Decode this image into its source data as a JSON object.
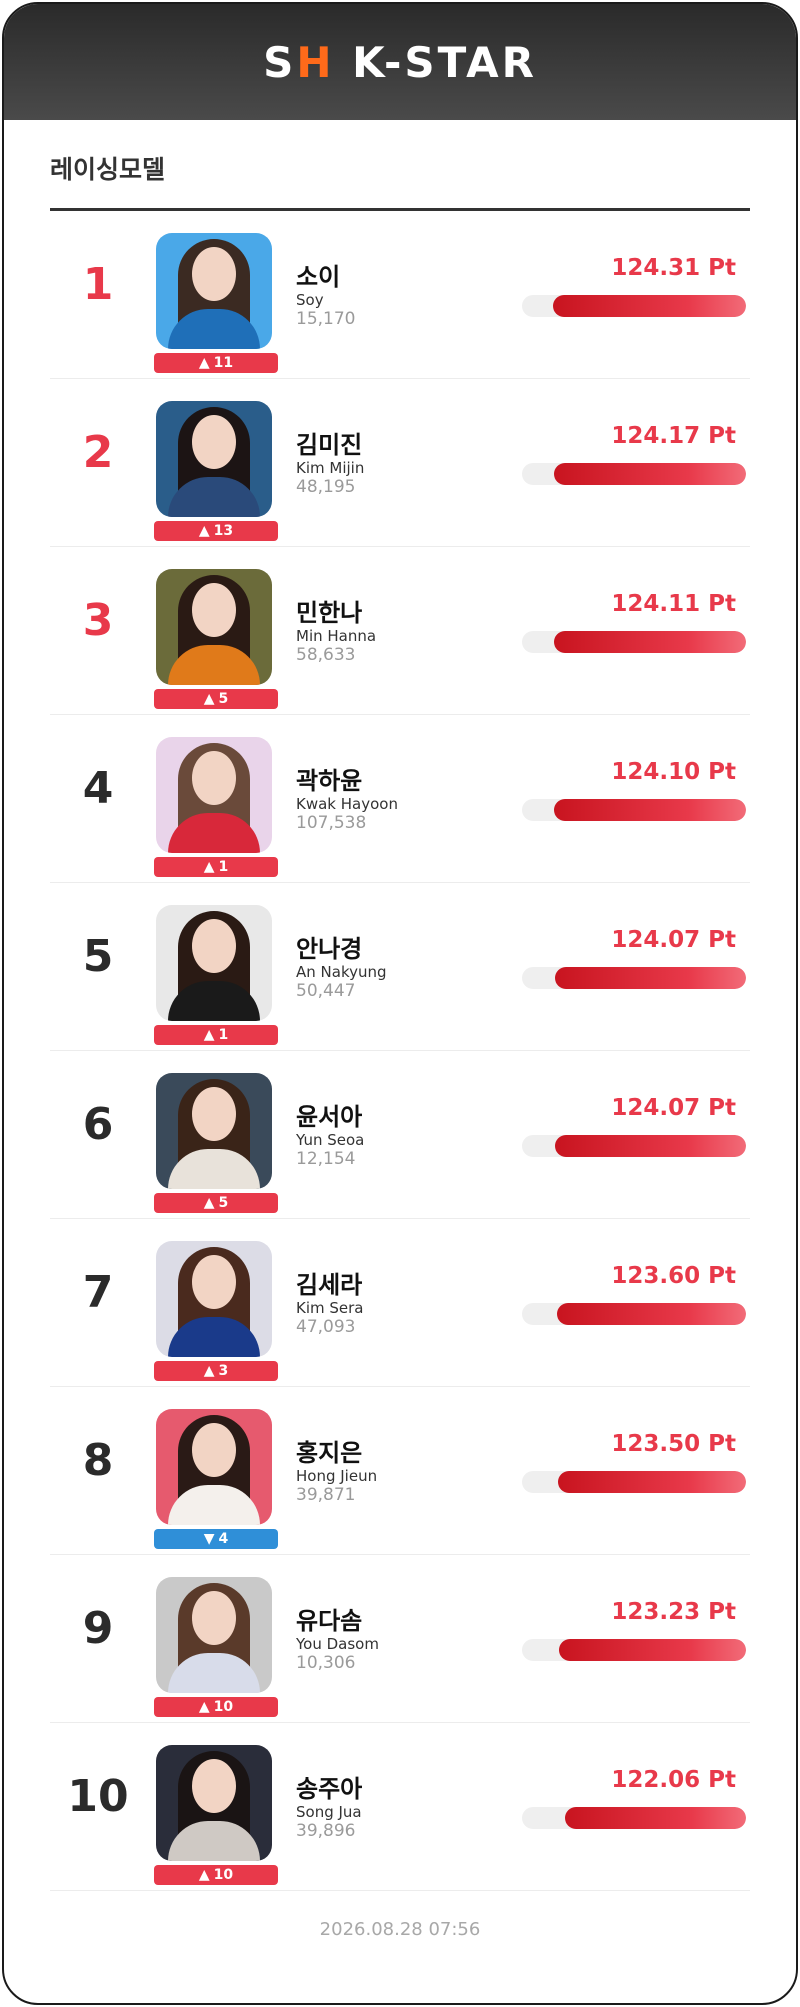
{
  "header": {
    "logo_prefix": "S",
    "logo_accent": "H",
    "logo_rest": " K-STAR"
  },
  "section_title": "레이싱모델",
  "colors": {
    "accent": "#e8394a",
    "up": "#e8394a",
    "down": "#2f8fd8"
  },
  "ranking": [
    {
      "rank": "1",
      "korean_name": "소이",
      "english_name": "Soy",
      "votes": "15,170",
      "score": "124.31 Pt",
      "score_value": 124.31,
      "change_dir": "up",
      "change_icon": "▲",
      "change": "11"
    },
    {
      "rank": "2",
      "korean_name": "김미진",
      "english_name": "Kim Mijin",
      "votes": "48,195",
      "score": "124.17 Pt",
      "score_value": 124.17,
      "change_dir": "up",
      "change_icon": "▲",
      "change": "13"
    },
    {
      "rank": "3",
      "korean_name": "민한나",
      "english_name": "Min Hanna",
      "votes": "58,633",
      "score": "124.11 Pt",
      "score_value": 124.11,
      "change_dir": "up",
      "change_icon": "▲",
      "change": "5"
    },
    {
      "rank": "4",
      "korean_name": "곽하윤",
      "english_name": "Kwak Hayoon",
      "votes": "107,538",
      "score": "124.10 Pt",
      "score_value": 124.1,
      "change_dir": "up",
      "change_icon": "▲",
      "change": "1"
    },
    {
      "rank": "5",
      "korean_name": "안나경",
      "english_name": "An Nakyung",
      "votes": "50,447",
      "score": "124.07 Pt",
      "score_value": 124.07,
      "change_dir": "up",
      "change_icon": "▲",
      "change": "1"
    },
    {
      "rank": "6",
      "korean_name": "윤서아",
      "english_name": "Yun Seoa",
      "votes": "12,154",
      "score": "124.07 Pt",
      "score_value": 124.07,
      "change_dir": "up",
      "change_icon": "▲",
      "change": "5"
    },
    {
      "rank": "7",
      "korean_name": "김세라",
      "english_name": "Kim Sera",
      "votes": "47,093",
      "score": "123.60 Pt",
      "score_value": 123.6,
      "change_dir": "up",
      "change_icon": "▲",
      "change": "3"
    },
    {
      "rank": "8",
      "korean_name": "홍지은",
      "english_name": "Hong Jieun",
      "votes": "39,871",
      "score": "123.50 Pt",
      "score_value": 123.5,
      "change_dir": "down",
      "change_icon": "▼",
      "change": "4"
    },
    {
      "rank": "9",
      "korean_name": "유다솜",
      "english_name": "You Dasom",
      "votes": "10,306",
      "score": "123.23 Pt",
      "score_value": 123.23,
      "change_dir": "up",
      "change_icon": "▲",
      "change": "10"
    },
    {
      "rank": "10",
      "korean_name": "송주아",
      "english_name": "Song Jua",
      "votes": "39,896",
      "score": "122.06 Pt",
      "score_value": 122.06,
      "change_dir": "up",
      "change_icon": "▲",
      "change": "10"
    }
  ],
  "timestamp": "2026.08.28 07:56"
}
